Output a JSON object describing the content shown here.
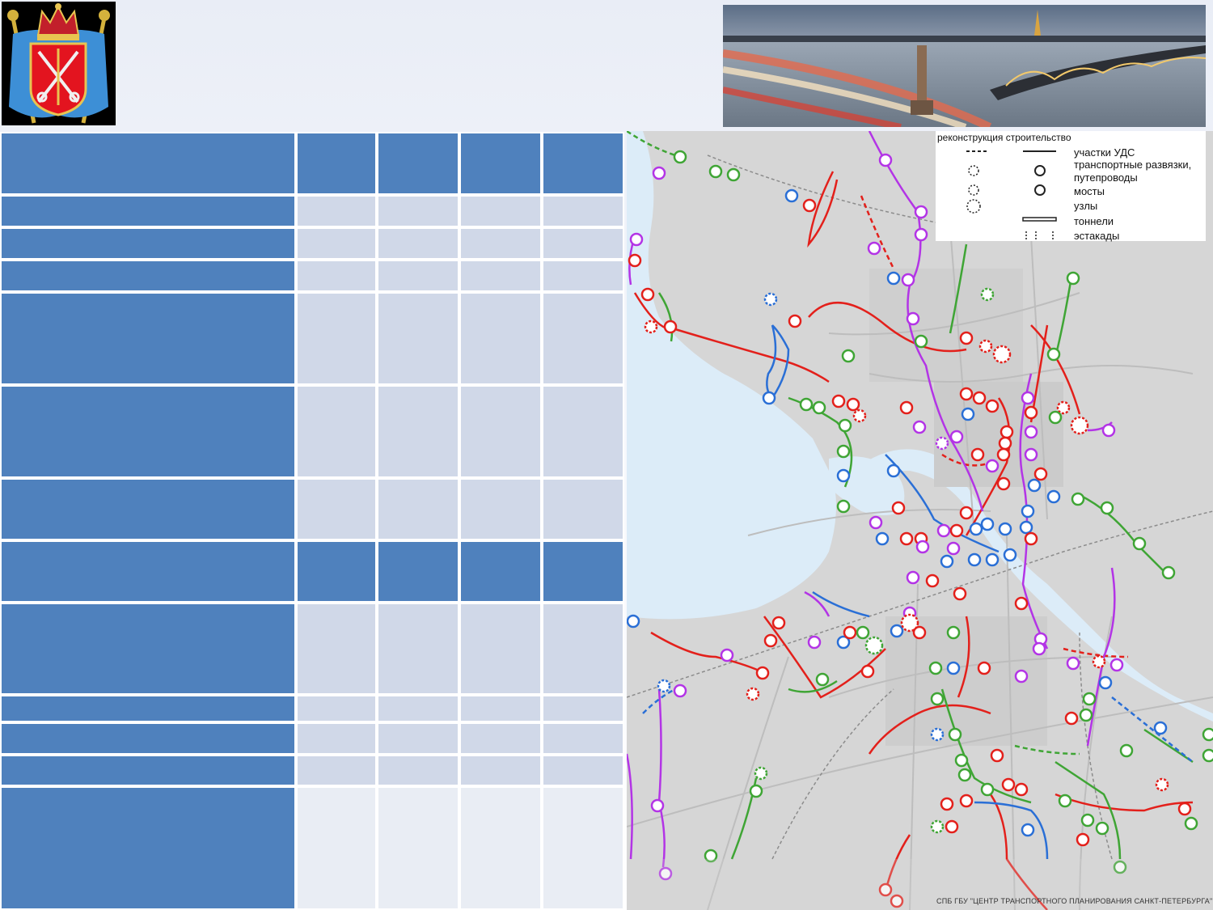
{
  "header": {
    "crest_icon": "saint-petersburg-coat-of-arms-icon",
    "photo_icon": "trinity-bridge-night-photo"
  },
  "table": {
    "rows": [
      {
        "kind": "head",
        "h": 78
      },
      {
        "kind": "body",
        "h": 40
      },
      {
        "kind": "body",
        "h": 40
      },
      {
        "kind": "body",
        "h": 40
      },
      {
        "kind": "body",
        "h": 115
      },
      {
        "kind": "body",
        "h": 115
      },
      {
        "kind": "body",
        "h": 77
      },
      {
        "kind": "head",
        "h": 77
      },
      {
        "kind": "body",
        "h": 114
      },
      {
        "kind": "body",
        "h": 34
      },
      {
        "kind": "body",
        "h": 40
      },
      {
        "kind": "body",
        "h": 39
      },
      {
        "kind": "light",
        "h": 153
      }
    ]
  },
  "map": {
    "legend": {
      "title": "реконструкция строительство",
      "items": [
        {
          "label": "участки УДС",
          "icon": "road-section-icon"
        },
        {
          "label": "транспортные развязки,",
          "icon": "interchange-icon"
        },
        {
          "label": "путепроводы",
          "icon": "overpass-icon"
        },
        {
          "label": "мосты",
          "icon": "bridge-icon"
        },
        {
          "label": "узлы",
          "icon": "node-icon"
        },
        {
          "label": "тоннели",
          "icon": "tunnel-icon"
        },
        {
          "label": "эстакады",
          "icon": "flyover-icon"
        }
      ]
    },
    "credit": "СПБ ГБУ \"ЦЕНТР ТРАНСПОРТНОГО ПЛАНИРОВАНИЯ САНКТ-ПЕТЕРБУРГА\"",
    "colors": {
      "red": "#e3201b",
      "green": "#3fa535",
      "blue": "#2a6fd6",
      "purple": "#b334e6",
      "water": "#dcecf8",
      "land": "#d6d6d6"
    }
  }
}
